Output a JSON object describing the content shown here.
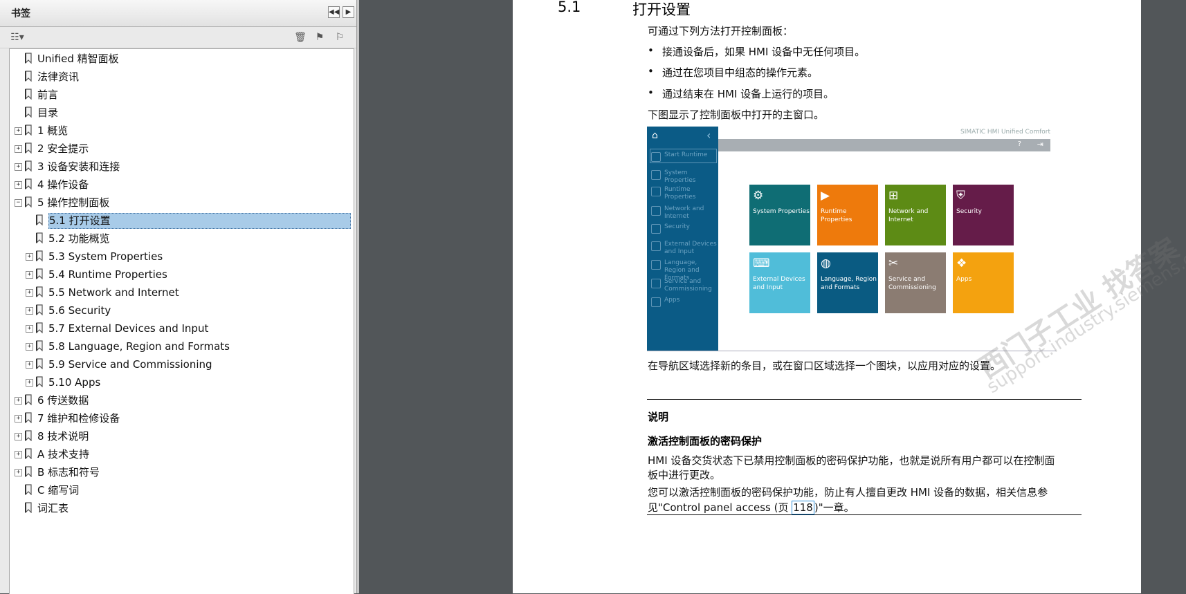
{
  "bookmarks_panel": {
    "title": "书签",
    "items": [
      {
        "label": "Unified 精智面板",
        "expander": ""
      },
      {
        "label": "法律资讯",
        "expander": ""
      },
      {
        "label": "前言",
        "expander": ""
      },
      {
        "label": "目录",
        "expander": ""
      },
      {
        "label": "1 概览",
        "expander": "+"
      },
      {
        "label": "2 安全提示",
        "expander": "+"
      },
      {
        "label": "3 设备安装和连接",
        "expander": "+"
      },
      {
        "label": "4 操作设备",
        "expander": "+"
      },
      {
        "label": "5 操作控制面板",
        "expander": "−"
      },
      {
        "label": "5.1 打开设置",
        "expander": ""
      },
      {
        "label": "5.2 功能概览",
        "expander": ""
      },
      {
        "label": "5.3 System Properties",
        "expander": "+"
      },
      {
        "label": "5.4 Runtime Properties",
        "expander": "+"
      },
      {
        "label": "5.5 Network and Internet",
        "expander": "+"
      },
      {
        "label": "5.6 Security",
        "expander": "+"
      },
      {
        "label": "5.7 External Devices and Input",
        "expander": "+"
      },
      {
        "label": "5.8 Language, Region and Formats",
        "expander": "+"
      },
      {
        "label": "5.9 Service and Commissioning",
        "expander": "+"
      },
      {
        "label": "5.10 Apps",
        "expander": "+"
      },
      {
        "label": "6 传送数据",
        "expander": "+"
      },
      {
        "label": "7 维护和检修设备",
        "expander": "+"
      },
      {
        "label": "8 技术说明",
        "expander": "+"
      },
      {
        "label": "A 技术支持",
        "expander": "+"
      },
      {
        "label": "B 标志和符号",
        "expander": "+"
      },
      {
        "label": "C 缩写词",
        "expander": ""
      },
      {
        "label": "词汇表",
        "expander": ""
      }
    ]
  },
  "document": {
    "section_number": "5.1",
    "section_title": "打开设置",
    "intro": "可通过下列方法打开控制面板：",
    "bullets": [
      "接通设备后，如果 HMI 设备中无任何项目。",
      "通过在您项目中组态的操作元素。",
      "通过结束在 HMI 设备上运行的项目。"
    ],
    "figure_caption": "下图显示了控制面板中打开的主窗口。",
    "after_figure": "在导航区域选择新的条目，或在窗口区域选择一个图块，以应用对应的设置。",
    "note_title": "说明",
    "note_subtitle": "激活控制面板的密码保护",
    "note_p1_line1": "HMI 设备交货状态下已禁用控制面板的密码保护功能，也就是说所有用户都可以在控制面",
    "note_p1_line2": "板中进行更改。",
    "note_p2_line1": "您可以激活控制面板的密码保护功能，防止有人擅自更改 HMI 设备的数据，相关信息参",
    "note_p2_prefix": "见\"Control panel access (页 ",
    "note_p2_link": "118",
    "note_p2_suffix": ")\"一章。"
  },
  "screenshot": {
    "brand": "SIMATIC HMI Unified Comfort",
    "nav": [
      "Start Runtime",
      "System Properties",
      "Runtime Properties",
      "Network and Internet",
      "Security",
      "External Devices and Input",
      "Language, Region and Formats",
      "Service and Commissioning",
      "Apps"
    ],
    "tiles": [
      {
        "label": "System Properties",
        "color": "#0f6d74",
        "icon": "⚙"
      },
      {
        "label": "Runtime Properties",
        "color": "#ee7a0c",
        "icon": "▶"
      },
      {
        "label": "Network and Internet",
        "color": "#5d8b15",
        "icon": "⊞"
      },
      {
        "label": "Security",
        "color": "#651c49",
        "icon": "⛨"
      },
      {
        "label": "External Devices and Input",
        "color": "#50bdd9",
        "icon": "⌨"
      },
      {
        "label": "Language, Region and Formats",
        "color": "#0a5b82",
        "icon": "◍"
      },
      {
        "label": "Service and Commissioning",
        "color": "#8b7c72",
        "icon": "✂"
      },
      {
        "label": "Apps",
        "color": "#f4a20f",
        "icon": "❖"
      }
    ]
  },
  "watermark": {
    "line1": "西门子工业  找答案",
    "line2": "support.industry.siemens.com/cs"
  }
}
